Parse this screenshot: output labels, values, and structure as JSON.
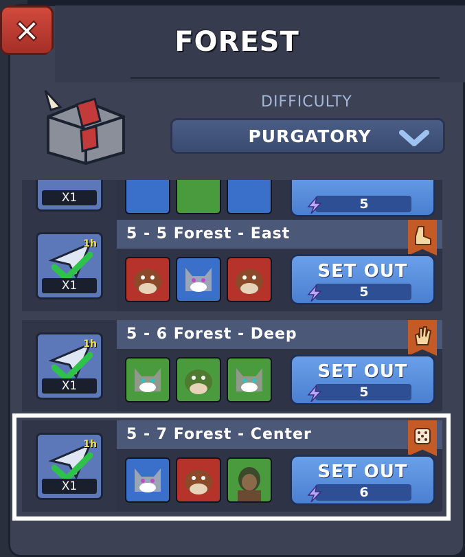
{
  "header": {
    "title": "FOREST"
  },
  "difficulty": {
    "label": "DIFFICULTY",
    "value": "PURGATORY"
  },
  "partial_stage": {
    "qty": "X1",
    "energy": "5",
    "enemies": [
      "blue",
      "green",
      "blue"
    ]
  },
  "stages": [
    {
      "title": "5 - 5 Forest - East",
      "qty": "X1",
      "time": "1h",
      "energy": "5",
      "button": "SET OUT",
      "ribbon_icon": "boot-icon",
      "enemies": [
        "red",
        "blue",
        "red"
      ]
    },
    {
      "title": "5 - 6 Forest - Deep",
      "qty": "X1",
      "time": "1h",
      "energy": "5",
      "button": "SET OUT",
      "ribbon_icon": "hand-icon",
      "enemies": [
        "green",
        "green",
        "green"
      ]
    },
    {
      "title": "5 - 7 Forest - Center",
      "qty": "X1",
      "time": "1h",
      "energy": "6",
      "button": "SET OUT",
      "ribbon_icon": "dice-icon",
      "enemies": [
        "blue",
        "red",
        "green"
      ]
    }
  ]
}
